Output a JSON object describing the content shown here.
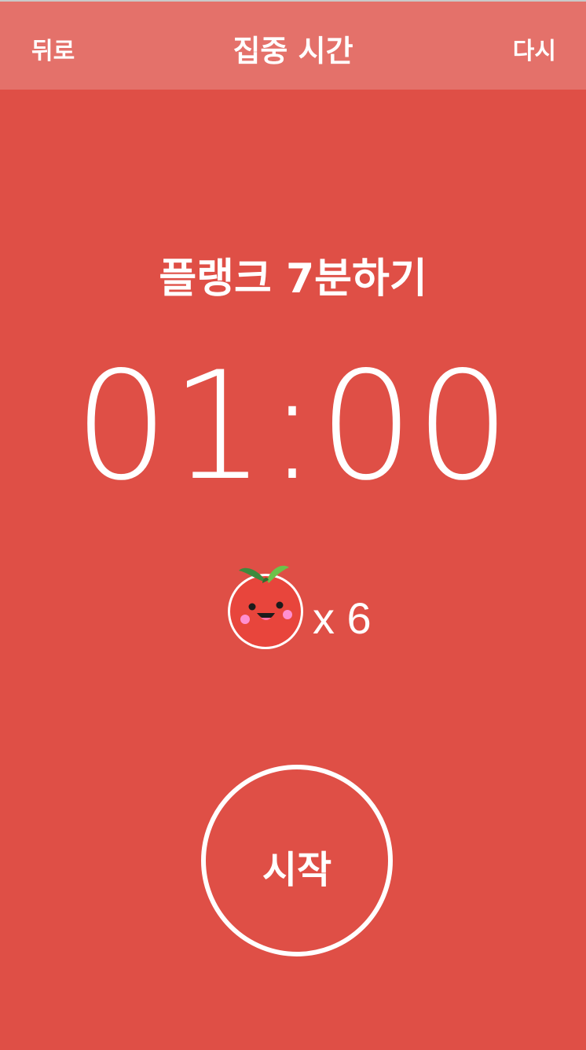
{
  "header": {
    "back_label": "뒤로",
    "title": "집중 시간",
    "reset_label": "다시"
  },
  "task": {
    "title": "플랭크 7분하기"
  },
  "timer": {
    "display": "01:00"
  },
  "pomodoro": {
    "icon": "tomato-icon",
    "count_label": "x 6"
  },
  "controls": {
    "start_label": "시작"
  },
  "colors": {
    "background": "#df4f46",
    "header": "#e4716a",
    "text": "#ffffff"
  }
}
